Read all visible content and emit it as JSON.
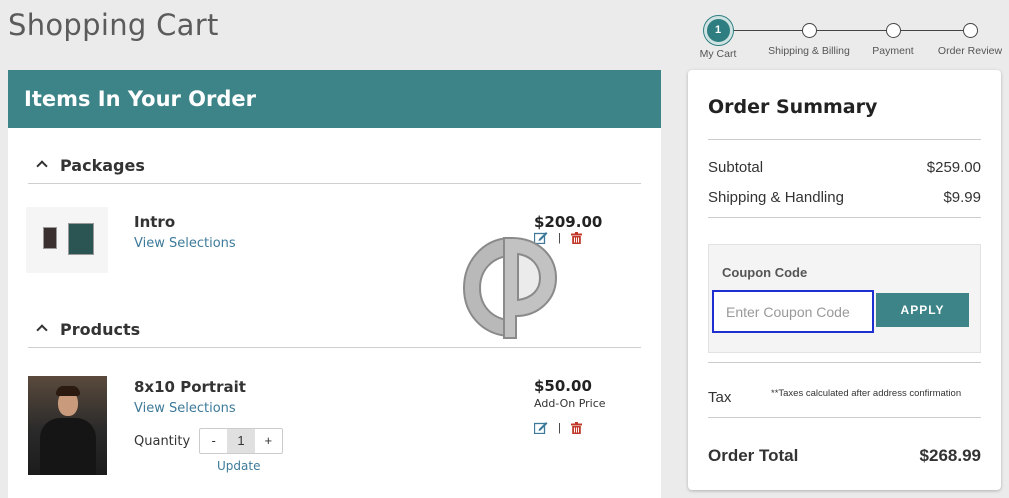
{
  "page": {
    "title": "Shopping Cart"
  },
  "steps": [
    {
      "number": "1",
      "label": "My Cart",
      "active": true
    },
    {
      "label": "Shipping & Billing"
    },
    {
      "label": "Payment"
    },
    {
      "label": "Order Review"
    }
  ],
  "order": {
    "header": "Items In Your Order",
    "packages": {
      "heading": "Packages",
      "items": [
        {
          "name": "Intro",
          "link": "View Selections",
          "price": "$209.00"
        }
      ]
    },
    "products": {
      "heading": "Products",
      "items": [
        {
          "name": "8x10 Portrait",
          "link": "View Selections",
          "price": "$50.00",
          "price_note": "Add-On Price",
          "quantity_label": "Quantity",
          "quantity": "1",
          "minus": "-",
          "plus": "+",
          "update": "Update"
        }
      ]
    },
    "action_separator": "|"
  },
  "summary": {
    "title": "Order Summary",
    "subtotal_label": "Subtotal",
    "subtotal": "$259.00",
    "shipping_label": "Shipping & Handling",
    "shipping": "$9.99",
    "coupon_label": "Coupon Code",
    "coupon_placeholder": "Enter Coupon Code",
    "apply_label": "APPLY",
    "tax_label": "Tax",
    "tax_note": "**Taxes calculated after address confirmation",
    "total_label": "Order Total",
    "total": "$268.99"
  },
  "colors": {
    "accent": "#3d8488",
    "link": "#3d7a9a",
    "focus": "#1d2fd0",
    "delete": "#c0392b"
  },
  "icons": [
    "edit-icon",
    "trash-icon",
    "chevron-up-icon",
    "watermark-logo"
  ]
}
